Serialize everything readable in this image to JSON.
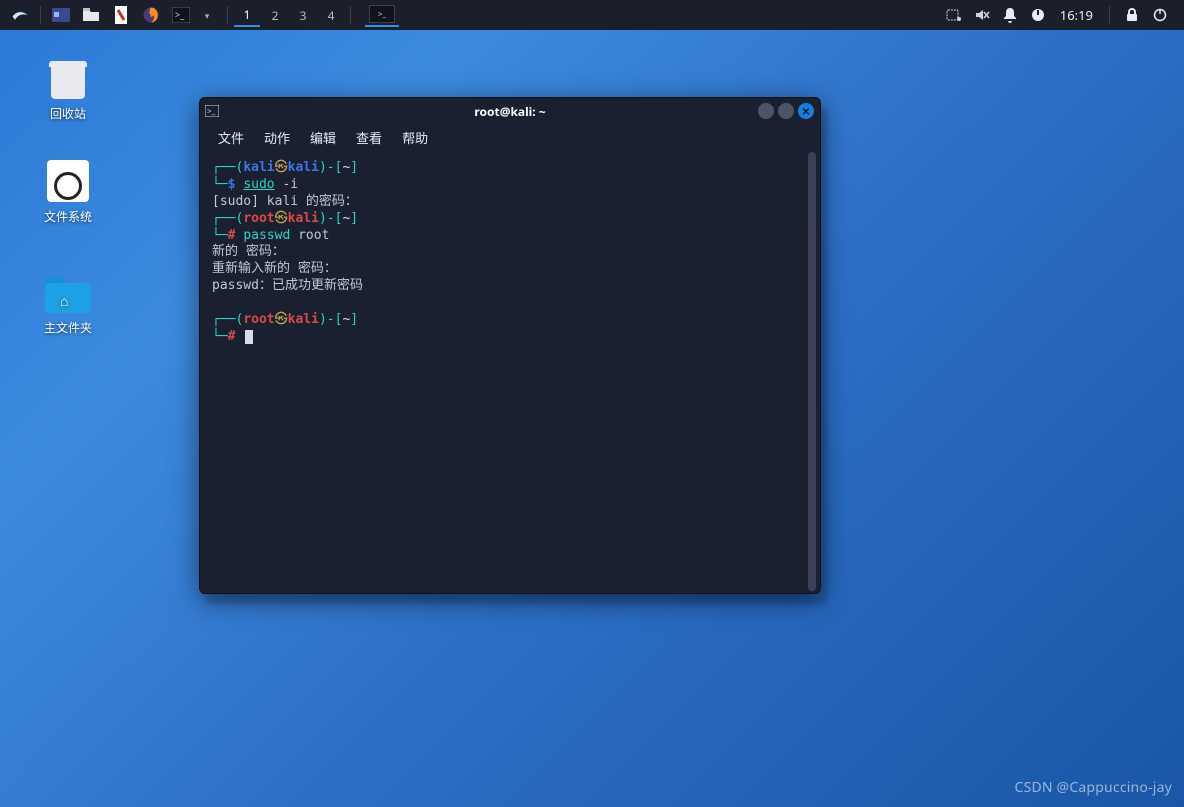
{
  "panel": {
    "workspaces": [
      "1",
      "2",
      "3",
      "4"
    ],
    "active_workspace": 0,
    "time": "16:19"
  },
  "desktop": {
    "trash_label": "回收站",
    "filesystem_label": "文件系统",
    "home_label": "主文件夹"
  },
  "terminal": {
    "title": "root@kali: ~",
    "menus": {
      "file": "文件",
      "action": "动作",
      "edit": "编辑",
      "view": "查看",
      "help": "帮助"
    },
    "lines": {
      "p1_user": "kali",
      "p1_host": "kali",
      "p1_path": "~",
      "p1_sym": "$",
      "p1_cmd": "sudo",
      "p1_arg": "-i",
      "sudo_prompt": "[sudo] kali 的密码：",
      "p2_user": "root",
      "p2_host": "kali",
      "p2_path": "~",
      "p2_sym": "#",
      "p2_cmd": "passwd",
      "p2_arg": "root",
      "new_pw": "新的 密码：",
      "retype": "重新输入新的 密码：",
      "success": "passwd：已成功更新密码",
      "p3_user": "root",
      "p3_host": "kali",
      "p3_path": "~",
      "p3_sym": "#"
    }
  },
  "watermark": "CSDN @Cappuccino-jay"
}
